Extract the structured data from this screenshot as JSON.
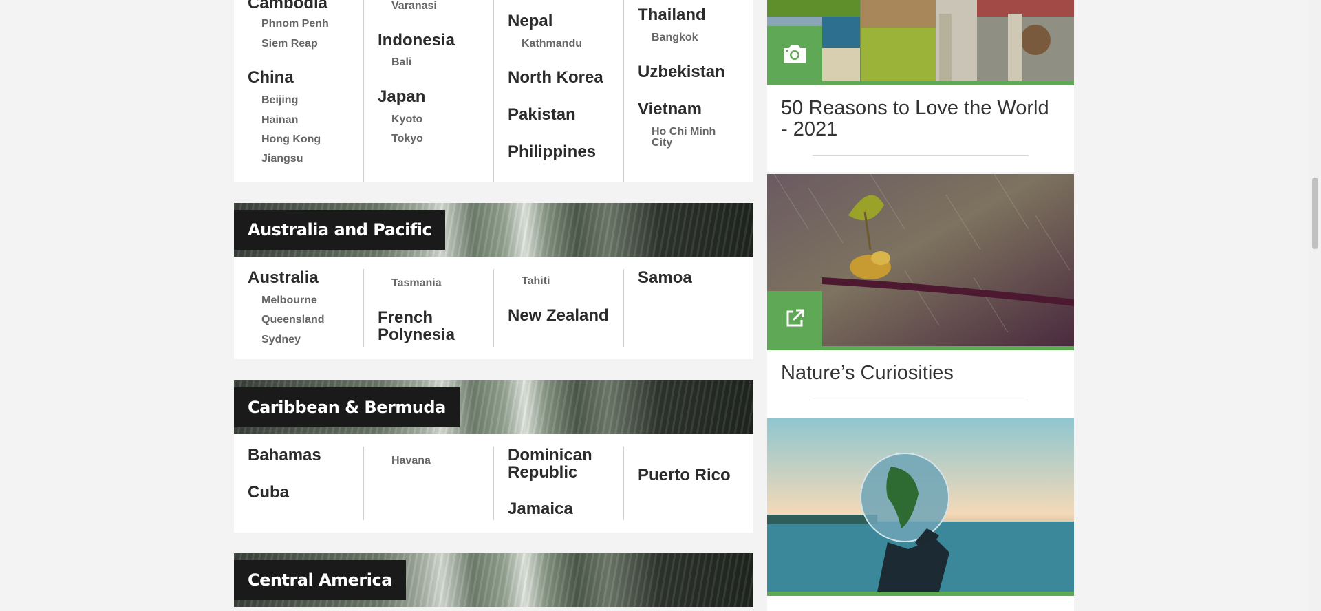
{
  "asia": {
    "col1": [
      {
        "name": "Cambodia",
        "cities": [
          "Phnom Penh",
          "Siem Reap"
        ]
      },
      {
        "name": "China",
        "cities": [
          "Beijing",
          "Hainan",
          "Hong Kong",
          "Jiangsu"
        ]
      }
    ],
    "col2_top_city": "Varanasi",
    "col2": [
      {
        "name": "Indonesia",
        "cities": [
          "Bali"
        ]
      },
      {
        "name": "Japan",
        "cities": [
          "Kyoto",
          "Tokyo"
        ]
      }
    ],
    "col3": [
      {
        "name": "Nepal",
        "cities": [
          "Kathmandu"
        ]
      },
      {
        "name": "North Korea",
        "cities": []
      },
      {
        "name": "Pakistan",
        "cities": []
      },
      {
        "name": "Philippines",
        "cities": []
      }
    ],
    "col4": [
      {
        "name": "Thailand",
        "cities": [
          "Bangkok"
        ]
      },
      {
        "name": "Uzbekistan",
        "cities": []
      },
      {
        "name": "Vietnam",
        "cities": [
          "Ho Chi Minh City"
        ]
      }
    ]
  },
  "australia_pacific": {
    "title": "Australia and Pacific",
    "australia": {
      "name": "Australia",
      "cities": [
        "Melbourne",
        "Queensland",
        "Sydney"
      ]
    },
    "col2_city": "Tasmania",
    "french_polynesia": "French Polynesia",
    "col3_city": "Tahiti",
    "new_zealand": "New Zealand",
    "samoa": "Samoa"
  },
  "caribbean": {
    "title": "Caribbean & Bermuda",
    "bahamas": "Bahamas",
    "cuba": "Cuba",
    "havana": "Havana",
    "dominican": "Dominican Republic",
    "jamaica": "Jamaica",
    "puerto_rico": "Puerto Rico"
  },
  "central_america": {
    "title": "Central America"
  },
  "sidebar": {
    "items": [
      {
        "title": "50 Reasons to Love the World - 2021",
        "icon": "camera-icon"
      },
      {
        "title": "Nature’s Curiosities",
        "icon": "external-link-icon"
      }
    ],
    "accent": "#5fa855"
  }
}
